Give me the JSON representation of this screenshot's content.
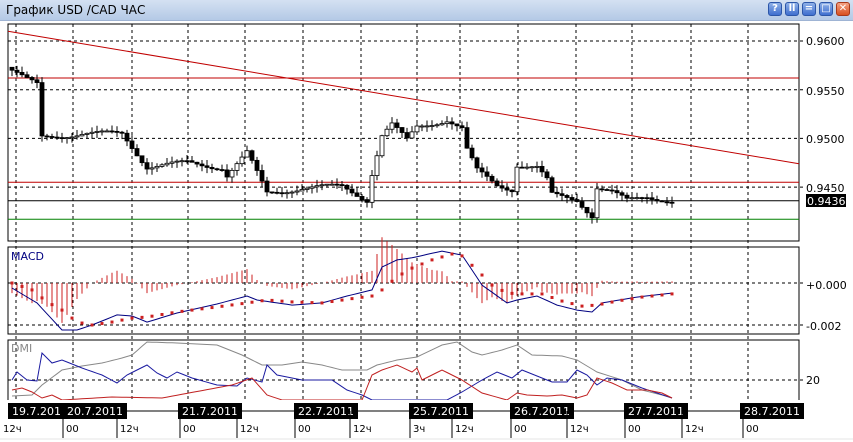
{
  "window": {
    "title": "График USD /CAD  ЧАС",
    "buttons": [
      {
        "name": "help",
        "glyph": "?"
      },
      {
        "name": "pause",
        "glyph": "ll"
      },
      {
        "name": "minimize",
        "glyph": "="
      },
      {
        "name": "maximize",
        "glyph": "□"
      },
      {
        "name": "close",
        "glyph": "✕"
      }
    ]
  },
  "colors": {
    "trend": "#c00000",
    "support": "#c00000",
    "green": "#008000",
    "macd": "#000080",
    "signal": "#cc2020",
    "di_plus": "#1a1aa0",
    "di_minus": "#c02020",
    "adx": "#888888"
  },
  "price_axis": {
    "ticks": [
      "0.9600",
      "0.9550",
      "0.9500",
      "0.9450"
    ],
    "tick_values": [
      0.96,
      0.955,
      0.95,
      0.945
    ],
    "current_price": "0.9436",
    "current_value": 0.9436
  },
  "levels": {
    "resistance": 0.9562,
    "support": 0.9455,
    "green": 0.9417,
    "trend_start": 0.961,
    "trend_end": 0.9474
  },
  "macd_panel": {
    "label": "MACD",
    "ticks": [
      "+0.000",
      "-0.002"
    ],
    "tick_values": [
      0,
      -0.002
    ]
  },
  "dmi_panel": {
    "label": "DMI",
    "ticks": [
      "20"
    ],
    "tick_values": [
      20
    ]
  },
  "time_axis": {
    "dates": [
      "19.7.201",
      "20.7.2011",
      "21.7.2011",
      "22.7.2011",
      "25.7.2011",
      "26.7.2011",
      "27.7.2011",
      "28.7.2011"
    ],
    "hours": [
      "12ч",
      "00",
      "12ч",
      "00",
      "12ч",
      "00",
      "12ч",
      "3ч",
      "12ч",
      "00",
      "12ч",
      "00",
      "12ч",
      "00"
    ]
  },
  "chart_data": {
    "type": "candlestick",
    "symbol": "USD/CAD",
    "timeframe": "H1",
    "candle_count": 133,
    "close_path": [
      [
        0,
        0.957
      ],
      [
        3,
        0.956
      ],
      [
        5,
        0.9555
      ],
      [
        6,
        0.9501
      ],
      [
        14,
        0.9505
      ],
      [
        22,
        0.9505
      ],
      [
        27,
        0.9471
      ],
      [
        35,
        0.9475
      ],
      [
        42,
        0.947
      ],
      [
        43,
        0.9462
      ],
      [
        47,
        0.9485
      ],
      [
        51,
        0.9444
      ],
      [
        58,
        0.9449
      ],
      [
        66,
        0.9451
      ],
      [
        71,
        0.9437
      ],
      [
        72,
        0.9464
      ],
      [
        74,
        0.9503
      ],
      [
        76,
        0.9514
      ],
      [
        79,
        0.9498
      ],
      [
        81,
        0.9512
      ],
      [
        87,
        0.9519
      ],
      [
        90,
        0.951
      ],
      [
        91,
        0.9488
      ],
      [
        93,
        0.9467
      ],
      [
        97,
        0.9452
      ],
      [
        100,
        0.9448
      ],
      [
        101,
        0.9473
      ],
      [
        105,
        0.947
      ],
      [
        107,
        0.9457
      ],
      [
        108,
        0.9442
      ],
      [
        113,
        0.9437
      ],
      [
        116,
        0.9421
      ],
      [
        117,
        0.945
      ],
      [
        120,
        0.9445
      ],
      [
        123,
        0.9436
      ],
      [
        127,
        0.944
      ],
      [
        132,
        0.9436
      ]
    ],
    "macd": [
      [
        0,
        -0.00024
      ],
      [
        5,
        -0.00095
      ],
      [
        10,
        -0.00224
      ],
      [
        13,
        -0.00224
      ],
      [
        16,
        -0.002
      ],
      [
        21,
        -0.00152
      ],
      [
        24,
        -0.00157
      ],
      [
        27,
        -0.00186
      ],
      [
        33,
        -0.00143
      ],
      [
        41,
        -0.001
      ],
      [
        47,
        -0.00062
      ],
      [
        49,
        -0.00081
      ],
      [
        56,
        -0.00105
      ],
      [
        62,
        -0.00095
      ],
      [
        67,
        -0.00062
      ],
      [
        72,
        -0.00033
      ],
      [
        74,
        0.00076
      ],
      [
        77,
        0.0011
      ],
      [
        80,
        0.0012
      ],
      [
        86,
        0.00152
      ],
      [
        90,
        0.00133
      ],
      [
        92,
        0.00062
      ],
      [
        94,
        -0.0001
      ],
      [
        99,
        -0.00095
      ],
      [
        101,
        -0.00081
      ],
      [
        105,
        -0.00062
      ],
      [
        109,
        -0.00105
      ],
      [
        113,
        -0.00129
      ],
      [
        116,
        -0.00138
      ],
      [
        118,
        -0.00095
      ],
      [
        125,
        -0.00067
      ],
      [
        132,
        -0.00048
      ]
    ],
    "signal": [
      [
        0,
        0
      ],
      [
        4,
        -0.00033
      ],
      [
        7,
        -0.0009
      ],
      [
        10,
        -0.00129
      ],
      [
        13,
        -0.00186
      ],
      [
        16,
        -0.002
      ],
      [
        20,
        -0.00186
      ],
      [
        24,
        -0.00167
      ],
      [
        27,
        -0.00162
      ],
      [
        33,
        -0.00138
      ],
      [
        41,
        -0.00114
      ],
      [
        47,
        -0.00095
      ],
      [
        51,
        -0.00081
      ],
      [
        56,
        -0.0009
      ],
      [
        62,
        -0.00095
      ],
      [
        69,
        -0.00071
      ],
      [
        72,
        -0.00062
      ],
      [
        74,
        -0.00033
      ],
      [
        77,
        0.00029
      ],
      [
        80,
        0.00071
      ],
      [
        84,
        0.0011
      ],
      [
        88,
        0.00138
      ],
      [
        90,
        0.00129
      ],
      [
        93,
        0.00062
      ],
      [
        96,
        -0.0001
      ],
      [
        99,
        -0.00048
      ],
      [
        102,
        -0.00052
      ],
      [
        106,
        -0.00052
      ],
      [
        110,
        -0.00086
      ],
      [
        114,
        -0.0011
      ],
      [
        117,
        -0.00105
      ],
      [
        121,
        -0.00086
      ],
      [
        126,
        -0.00067
      ],
      [
        132,
        -0.00052
      ]
    ],
    "adx": [
      [
        0,
        12
      ],
      [
        4,
        12.5
      ],
      [
        6,
        17.5
      ],
      [
        10,
        25
      ],
      [
        14,
        27
      ],
      [
        18,
        28.5
      ],
      [
        22,
        31
      ],
      [
        24,
        32.5
      ],
      [
        27,
        39
      ],
      [
        33,
        38.5
      ],
      [
        41,
        37.5
      ],
      [
        46,
        32.5
      ],
      [
        50,
        27.5
      ],
      [
        54,
        27.5
      ],
      [
        58,
        29
      ],
      [
        62,
        27.5
      ],
      [
        66,
        25
      ],
      [
        71,
        25
      ],
      [
        73,
        27.5
      ],
      [
        77,
        30
      ],
      [
        81,
        31.5
      ],
      [
        86,
        37.5
      ],
      [
        89,
        39
      ],
      [
        92,
        34
      ],
      [
        94,
        32.5
      ],
      [
        98,
        35
      ],
      [
        101,
        37.5
      ],
      [
        104,
        32.5
      ],
      [
        110,
        32
      ],
      [
        113,
        30
      ],
      [
        117,
        24
      ],
      [
        122,
        20
      ],
      [
        126,
        15
      ],
      [
        130,
        12.5
      ],
      [
        132,
        11
      ]
    ],
    "di_plus": [
      [
        0,
        20
      ],
      [
        1,
        24
      ],
      [
        3,
        20
      ],
      [
        5,
        19.5
      ],
      [
        6,
        33.5
      ],
      [
        8,
        28.5
      ],
      [
        10,
        30
      ],
      [
        14,
        26
      ],
      [
        18,
        22.5
      ],
      [
        21,
        18.5
      ],
      [
        23,
        22.5
      ],
      [
        27,
        27.5
      ],
      [
        29,
        23.5
      ],
      [
        31,
        21
      ],
      [
        33,
        24
      ],
      [
        36,
        21
      ],
      [
        41,
        17.5
      ],
      [
        45,
        17
      ],
      [
        47,
        21
      ],
      [
        50,
        19
      ],
      [
        51,
        27.5
      ],
      [
        53,
        22.5
      ],
      [
        58,
        20
      ],
      [
        64,
        20
      ],
      [
        67,
        15
      ],
      [
        70,
        12.5
      ],
      [
        72,
        10
      ],
      [
        87,
        10
      ],
      [
        90,
        14
      ],
      [
        94,
        20
      ],
      [
        97,
        24
      ],
      [
        100,
        21
      ],
      [
        102,
        25
      ],
      [
        105,
        22
      ],
      [
        108,
        19
      ],
      [
        111,
        19
      ],
      [
        113,
        25
      ],
      [
        115,
        22.5
      ],
      [
        117,
        17.5
      ],
      [
        119,
        21
      ],
      [
        122,
        20
      ],
      [
        126,
        16
      ],
      [
        132,
        11
      ]
    ],
    "di_minus": [
      [
        0,
        15
      ],
      [
        2,
        16
      ],
      [
        4,
        14
      ],
      [
        6,
        11
      ],
      [
        8,
        12.5
      ],
      [
        10,
        10
      ],
      [
        20,
        11.5
      ],
      [
        30,
        11
      ],
      [
        44,
        17.5
      ],
      [
        48,
        21
      ],
      [
        51,
        12.5
      ],
      [
        54,
        10
      ],
      [
        70,
        10
      ],
      [
        72,
        22.5
      ],
      [
        74,
        25
      ],
      [
        77,
        27.5
      ],
      [
        80,
        24
      ],
      [
        81,
        26
      ],
      [
        82,
        20
      ],
      [
        86,
        25
      ],
      [
        90,
        20
      ],
      [
        94,
        13.5
      ],
      [
        99,
        10
      ],
      [
        101,
        13.5
      ],
      [
        103,
        12.5
      ],
      [
        107,
        12
      ],
      [
        110,
        12.5
      ],
      [
        113,
        11
      ],
      [
        115,
        12.5
      ],
      [
        117,
        21
      ],
      [
        120,
        18.5
      ],
      [
        123,
        15
      ],
      [
        127,
        15
      ],
      [
        130,
        13.5
      ],
      [
        132,
        11
      ]
    ]
  }
}
